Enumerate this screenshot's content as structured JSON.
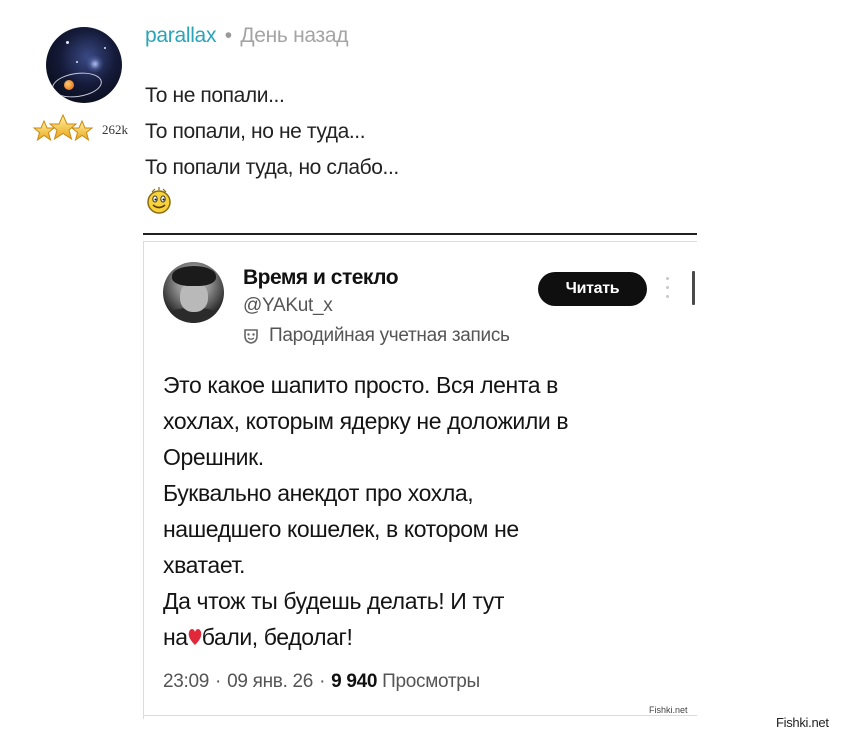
{
  "comment": {
    "username": "parallax",
    "separator": "•",
    "timestamp": "День назад",
    "rank_count": "262k",
    "rank_icon": "three-gold-stars-icon",
    "lines": [
      "То не попали...",
      "То попали, но не туда...",
      "То попали туда, но слабо..."
    ],
    "emoji_icon": "smiley-icon"
  },
  "embed": {
    "author_name": "Время и стекло",
    "author_handle": "@YAKut_x",
    "parody_label": "Пародийная учетная запись",
    "follow_label": "Читать",
    "text_lines": [
      "Это какое шапито просто. Вся лента в",
      "хохлах, которым ядерку не доложили в",
      "Орешник.",
      "Буквально анекдот про хохла,",
      "нашедшего кошелек, в котором не",
      "хватает.",
      "Да чтож ты будешь делать! И тут"
    ],
    "last_line_prefix": "на",
    "last_line_suffix": "бали, бедолаг!",
    "time": "23:09",
    "date": "09 янв. 26",
    "dot": "·",
    "views_count": "9 940",
    "views_label": "Просмотры",
    "mini_watermark": "Fishki.net",
    "heart_color": "#e0283a"
  },
  "page": {
    "watermark": "Fishki.net"
  },
  "colors": {
    "username": "#2aa4b8",
    "muted": "#a4a4a4",
    "button_bg": "#0f0f0f"
  }
}
